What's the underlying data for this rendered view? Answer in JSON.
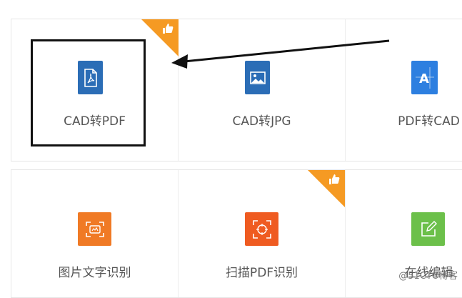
{
  "tools_row1": [
    {
      "label": "CAD转PDF",
      "icon": "pdf-file-icon",
      "color": "#2b6db6",
      "hot": false
    },
    {
      "label": "CAD转JPG",
      "icon": "image-icon",
      "color": "#2b6db6",
      "hot": true
    },
    {
      "label": "PDF转CAD",
      "icon": "cad-drawing-icon",
      "color": "#2d7fe0",
      "hot": false
    }
  ],
  "tools_row2": [
    {
      "label": "图片文字识别",
      "icon": "scan-text-icon",
      "color": "#f07a25",
      "hot": false
    },
    {
      "label": "扫描PDF识别",
      "icon": "scan-target-icon",
      "color": "#ef5b21",
      "hot": true
    },
    {
      "label": "在线编辑",
      "icon": "edit-icon",
      "color": "#6cc04a",
      "hot": false
    }
  ],
  "badge": {
    "color": "#f59a23",
    "icon": "thumbs-up-icon"
  },
  "watermark": "@51CTO博客"
}
